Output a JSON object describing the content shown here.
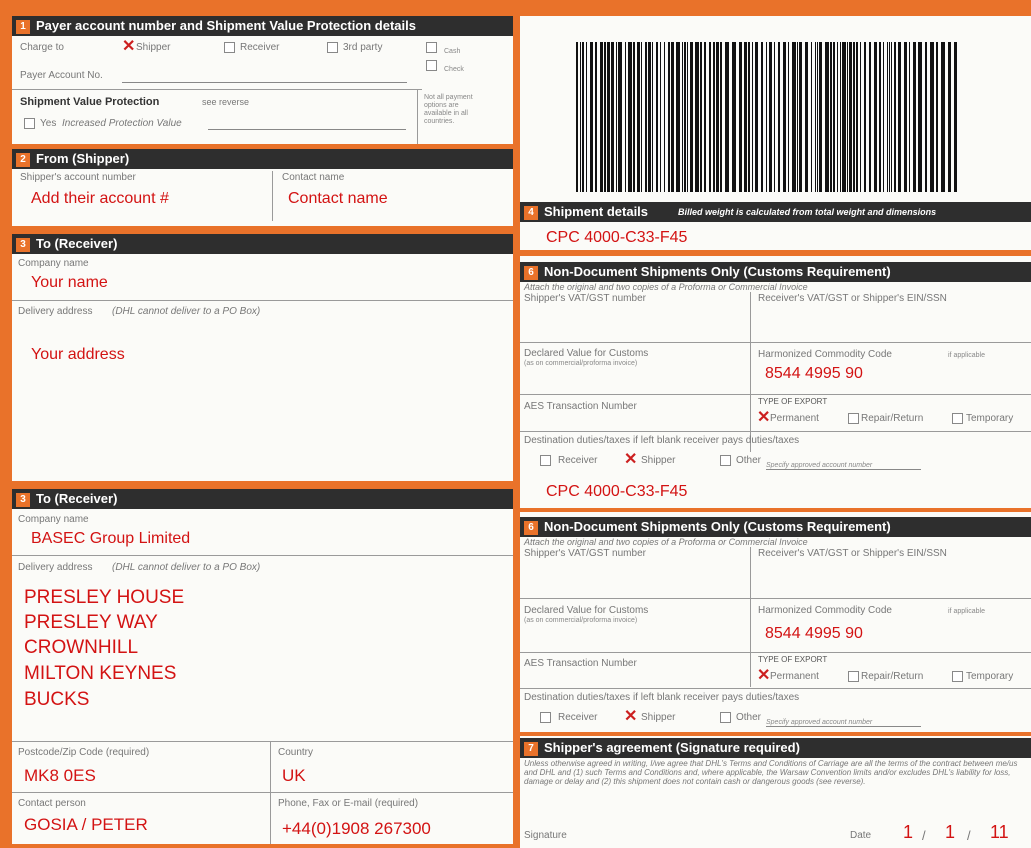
{
  "section1": {
    "num": "1",
    "title": "Payer account number and Shipment Value Protection details",
    "charge_to": "Charge to",
    "shipper": "Shipper",
    "receiver": "Receiver",
    "third_party": "3rd party",
    "cash": "Cash",
    "check": "Check",
    "payer_account": "Payer Account No.",
    "svp_title": "Shipment Value Protection",
    "see_reverse": "see reverse",
    "yes_label": "Yes",
    "increased_value": "Increased Protection Value",
    "not_all": "Not all payment options are available in all countries."
  },
  "from": {
    "num": "2",
    "title": "From (Shipper)",
    "acct_label": "Shipper's account number",
    "acct_value": "Add their account #",
    "contact_label": "Contact name",
    "contact_value": "Contact name"
  },
  "to1": {
    "num": "3",
    "title": "To (Receiver)",
    "company_label": "Company name",
    "company_value": "Your name",
    "address_label": "Delivery address",
    "address_note": "(DHL cannot deliver to a PO Box)",
    "address_value": "Your address"
  },
  "to2": {
    "num": "3",
    "title": "To (Receiver)",
    "company_label": "Company name",
    "company_value": "BASEC Group Limited",
    "address_label": "Delivery address",
    "address_note": "(DHL cannot deliver to a PO Box)",
    "address_lines": [
      "PRESLEY HOUSE",
      "PRESLEY WAY",
      "CROWNHILL",
      "MILTON KEYNES",
      "BUCKS"
    ],
    "postcode_label": "Postcode/Zip Code (required)",
    "postcode_value": "MK8 0ES",
    "country_label": "Country",
    "country_value": "UK",
    "contact_label": "Contact person",
    "contact_value": "GOSIA / PETER",
    "phone_label": "Phone, Fax or E-mail (required)",
    "phone_value": "+44(0)1908 267300"
  },
  "shipment": {
    "num": "4",
    "title": "Shipment details",
    "hint": "Billed weight is calculated from total weight and dimensions",
    "value": "CPC 4000-C33-F45"
  },
  "customs1": {
    "num": "6",
    "title": "Non-Document Shipments Only (Customs Requirement)",
    "attach": "Attach the original and two copies of a Proforma or Commercial Invoice",
    "shipper_vat": "Shipper's VAT/GST number",
    "receiver_vat": "Receiver's VAT/GST or Shipper's EIN/SSN",
    "declared": "Declared Value for Customs",
    "declared_note": "(as on commercial/proforma invoice)",
    "hs_label": "Harmonized Commodity Code",
    "hs_note": "if applicable",
    "hs_value": "8544 4995 90",
    "aes": "AES Transaction Number",
    "export_type": "TYPE OF EXPORT",
    "permanent": "Permanent",
    "repair": "Repair/Return",
    "temporary": "Temporary",
    "duties": "Destination duties/taxes if left blank receiver pays duties/taxes",
    "receiver": "Receiver",
    "shipper": "Shipper",
    "other": "Other",
    "approved": "Specify approved account number",
    "cpc": "CPC 4000-C33-F45"
  },
  "customs2": {
    "num": "6",
    "title": "Non-Document Shipments Only (Customs Requirement)",
    "attach": "Attach the original and two copies of a Proforma or Commercial Invoice",
    "shipper_vat": "Shipper's VAT/GST number",
    "receiver_vat": "Receiver's VAT/GST or Shipper's EIN/SSN",
    "declared": "Declared Value for Customs",
    "declared_note": "(as on commercial/proforma invoice)",
    "hs_label": "Harmonized Commodity Code",
    "hs_note": "if applicable",
    "hs_value": "8544 4995 90",
    "aes": "AES Transaction Number",
    "export_type": "TYPE OF EXPORT",
    "permanent": "Permanent",
    "repair": "Repair/Return",
    "temporary": "Temporary",
    "duties": "Destination duties/taxes if left blank receiver pays duties/taxes",
    "receiver": "Receiver",
    "shipper": "Shipper",
    "other": "Other",
    "approved": "Specify approved account number"
  },
  "agreement": {
    "num": "7",
    "title": "Shipper's agreement (Signature required)",
    "text": "Unless otherwise agreed in writing, I/we agree that DHL's Terms and Conditions of Carriage are all the terms of the contract between me/us and DHL and (1) such Terms and Conditions and, where applicable, the Warsaw Convention limits and/or excludes DHL's liability for loss, damage or delay and (2) this shipment does not contain cash or dangerous goods (see reverse).",
    "signature": "Signature",
    "date_label": "Date",
    "day": "1",
    "month": "1",
    "year": "11",
    "sep": "/"
  },
  "colors": {
    "accent": "#e9722a",
    "header": "#2e2e2e",
    "handwriting": "#d31313"
  }
}
